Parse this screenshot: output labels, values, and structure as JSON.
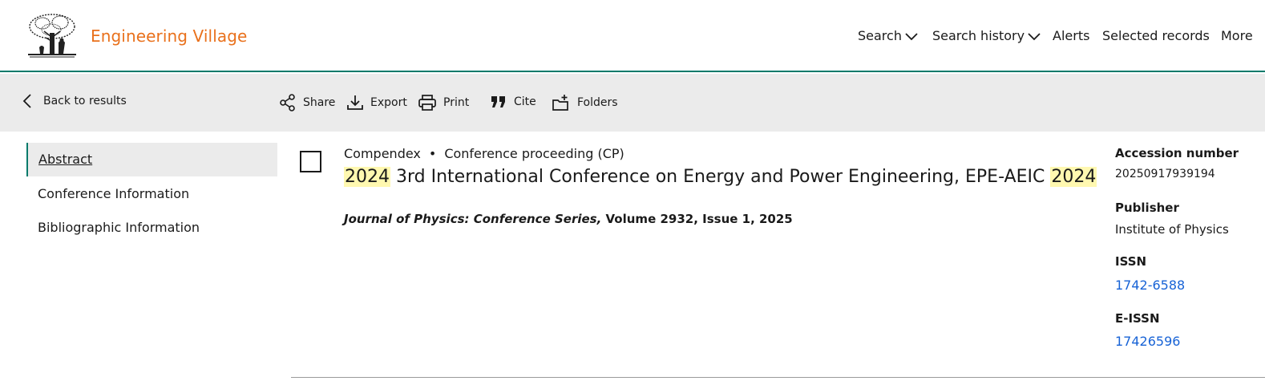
{
  "brand": {
    "name": "Engineering Village",
    "color": "#e9711c",
    "logo_icon": "elsevier-tree-logo"
  },
  "nav": {
    "items": [
      {
        "label": "Search",
        "has_chevron": true
      },
      {
        "label": "Search history",
        "has_chevron": true
      },
      {
        "label": "Alerts",
        "has_chevron": false
      },
      {
        "label": "Selected records",
        "has_chevron": false
      },
      {
        "label": "More",
        "has_chevron": false
      }
    ]
  },
  "toolbar": {
    "back_label": "Back to results",
    "actions": [
      {
        "label": "Share",
        "icon": "share-icon"
      },
      {
        "label": "Export",
        "icon": "download-icon"
      },
      {
        "label": "Print",
        "icon": "print-icon"
      },
      {
        "label": "Cite",
        "icon": "quote-icon"
      },
      {
        "label": "Folders",
        "icon": "folder-add-icon"
      }
    ]
  },
  "sidenav": {
    "items": [
      {
        "label": "Abstract",
        "active": true
      },
      {
        "label": "Conference Information",
        "active": false
      },
      {
        "label": "Bibliographic Information",
        "active": false
      }
    ]
  },
  "record": {
    "database": "Compendex",
    "separator": "•",
    "doc_type": "Conference proceeding (CP)",
    "title_parts": {
      "hl1": "2024",
      "middle": " 3rd International Conference on Energy and Power Engineering, EPE-AEIC ",
      "hl2": "2024"
    },
    "journal_name": "Journal of Physics: Conference Series,",
    "journal_details": " Volume 2932, Issue 1, 2025"
  },
  "details": {
    "accession_label": "Accession number",
    "accession_value": "20250917939194",
    "publisher_label": "Publisher",
    "publisher_value": "Institute of Physics",
    "issn_label": "ISSN",
    "issn_value": "1742-6588",
    "eissn_label": "E-ISSN",
    "eissn_value": "17426596"
  },
  "colors": {
    "accent": "#007a6b",
    "link": "#1863d6",
    "highlight": "#fff8b0",
    "toolbar_bg": "#ebebeb"
  }
}
